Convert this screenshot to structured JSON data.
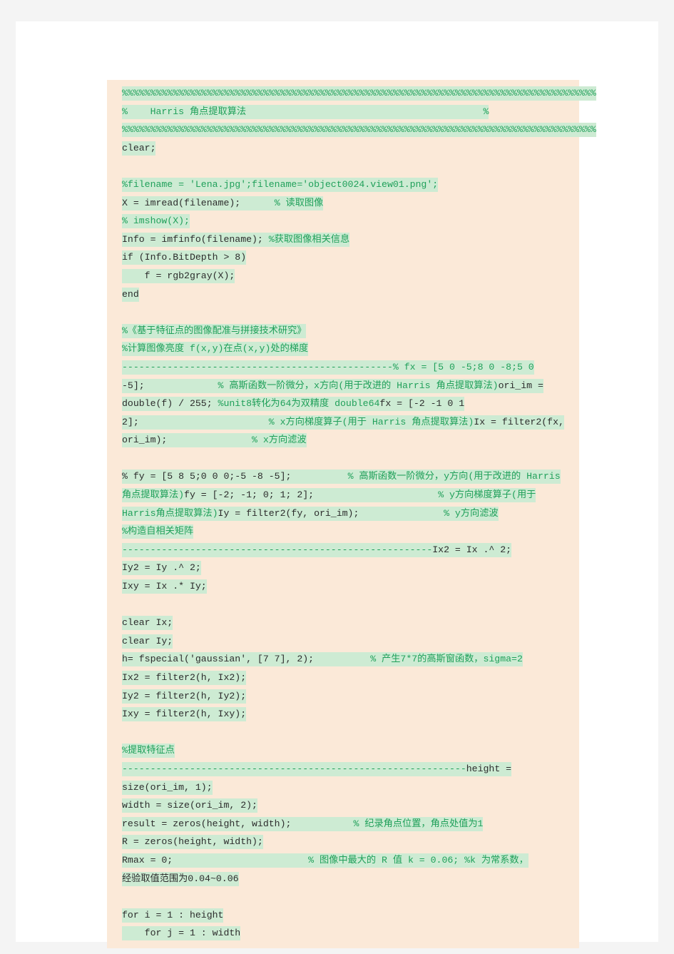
{
  "document": {
    "kind": "code-listing",
    "language": "MATLAB",
    "page_background": "#ffffff",
    "canvas_background": "#f4f4f4",
    "code_block_background": "#fbe9d8",
    "highlight_background": "#cdebd3",
    "code_text_color": "#2c2c2c",
    "comment_text_color": "#20a05a"
  },
  "code_lines": [
    {
      "id": "l01",
      "kind": "comment-banner",
      "text": "%%%%%%%%%%%%%%%%%%%%%%%%%%%%%%%%%%%%%%%%%%%%%%%%%%%%%%%%%%%%%%%%%%%%%%%%%%%%%%%%%%%%%"
    },
    {
      "id": "l02",
      "kind": "comment-title",
      "text": "%    Harris 角点提取算法                                          %"
    },
    {
      "id": "l03",
      "kind": "comment-banner",
      "text": "%%%%%%%%%%%%%%%%%%%%%%%%%%%%%%%%%%%%%%%%%%%%%%%%%%%%%%%%%%%%%%%%%%%%%%%%%%%%%%%%%%%%%"
    },
    {
      "id": "l04",
      "kind": "code",
      "text": "clear;"
    },
    {
      "id": "l05",
      "kind": "spacer",
      "text": ""
    },
    {
      "id": "l06",
      "kind": "comment",
      "text": "%filename = 'Lena.jpg';filename='object0024.view01.png';"
    },
    {
      "id": "l07",
      "kind": "code",
      "text": "X = imread(filename);      % 读取图像"
    },
    {
      "id": "l08",
      "kind": "comment",
      "text": "% imshow(X);"
    },
    {
      "id": "l09",
      "kind": "code",
      "text": "Info = imfinfo(filename); %获取图像相关信息"
    },
    {
      "id": "l10",
      "kind": "code",
      "text": "if (Info.BitDepth > 8)"
    },
    {
      "id": "l11",
      "kind": "code",
      "text": "    f = rgb2gray(X);"
    },
    {
      "id": "l12",
      "kind": "code",
      "text": "end"
    },
    {
      "id": "l13",
      "kind": "spacer",
      "text": ""
    },
    {
      "id": "l14",
      "kind": "comment",
      "text": "%《基于特征点的图像配准与拼接技术研究》"
    },
    {
      "id": "l15",
      "kind": "comment",
      "text": "%计算图像亮度 f(x,y)在点(x,y)处的梯度"
    },
    {
      "id": "l16",
      "kind": "comment",
      "text": "------------------------------------------------% fx = [5 0 -5;8 0 -8;5 0"
    },
    {
      "id": "l17",
      "kind": "mixed",
      "text": "-5];             % 高斯函数一阶微分，x方向(用于改进的 Harris 角点提取算法)ori_im ="
    },
    {
      "id": "l18",
      "kind": "mixed",
      "text": "double(f) / 255; %unit8转化为64为双精度 double64fx = [-2 -1 0 1"
    },
    {
      "id": "l19",
      "kind": "mixed",
      "text": "2];                       % x方向梯度算子(用于 Harris 角点提取算法)Ix = filter2(fx,"
    },
    {
      "id": "l20",
      "kind": "mixed",
      "text": "ori_im);               % x方向滤波"
    },
    {
      "id": "l21",
      "kind": "spacer",
      "text": ""
    },
    {
      "id": "l22",
      "kind": "mixed",
      "text": "% fy = [5 8 5;0 0 0;-5 -8 -5];          % 高斯函数一阶微分，y方向(用于改进的 Harris"
    },
    {
      "id": "l23",
      "kind": "mixed",
      "text": "角点提取算法)fy = [-2; -1; 0; 1; 2];                      % y方向梯度算子(用于"
    },
    {
      "id": "l24",
      "kind": "mixed",
      "text": "Harris角点提取算法)Iy = filter2(fy, ori_im);               % y方向滤波"
    },
    {
      "id": "l25",
      "kind": "comment",
      "text": "%构造自相关矩阵"
    },
    {
      "id": "l26",
      "kind": "mixed",
      "text": "-------------------------------------------------------Ix2 = Ix .^ 2;"
    },
    {
      "id": "l27",
      "kind": "code",
      "text": "Iy2 = Iy .^ 2;"
    },
    {
      "id": "l28",
      "kind": "code",
      "text": "Ixy = Ix .* Iy;"
    },
    {
      "id": "l29",
      "kind": "spacer",
      "text": ""
    },
    {
      "id": "l30",
      "kind": "code",
      "text": "clear Ix;"
    },
    {
      "id": "l31",
      "kind": "code",
      "text": "clear Iy;"
    },
    {
      "id": "l32",
      "kind": "code",
      "text": "h= fspecial('gaussian', [7 7], 2);          % 产生7*7的高斯窗函数，sigma=2"
    },
    {
      "id": "l33",
      "kind": "code",
      "text": "Ix2 = filter2(h, Ix2);"
    },
    {
      "id": "l34",
      "kind": "code",
      "text": "Iy2 = filter2(h, Iy2);"
    },
    {
      "id": "l35",
      "kind": "code",
      "text": "Ixy = filter2(h, Ixy);"
    },
    {
      "id": "l36",
      "kind": "spacer",
      "text": ""
    },
    {
      "id": "l37",
      "kind": "comment",
      "text": "%提取特征点"
    },
    {
      "id": "l38",
      "kind": "mixed",
      "text": "-------------------------------------------------------------height ="
    },
    {
      "id": "l39",
      "kind": "code",
      "text": "size(ori_im, 1);"
    },
    {
      "id": "l40",
      "kind": "code",
      "text": "width = size(ori_im, 2);"
    },
    {
      "id": "l41",
      "kind": "code",
      "text": "result = zeros(height, width);           % 纪录角点位置，角点处值为1"
    },
    {
      "id": "l42",
      "kind": "code",
      "text": "R = zeros(height, width);"
    },
    {
      "id": "l43",
      "kind": "code",
      "text": "Rmax = 0;                        % 图像中最大的 R 值 k = 0.06; %k 为常系数，"
    },
    {
      "id": "l44",
      "kind": "code",
      "text": "经验取值范围为0.04~0.06"
    },
    {
      "id": "l45",
      "kind": "spacer",
      "text": ""
    },
    {
      "id": "l46",
      "kind": "code",
      "text": "for i = 1 : height"
    },
    {
      "id": "l47",
      "kind": "code",
      "text": "    for j = 1 : width"
    }
  ],
  "segments": {
    "l01": [
      {
        "t": "%%%%%%%%%%%%%%%%%%%%%%%%%%%%%%%%%%%%%%%%%%%%%%%%%%%%%%%%%%%%%%%%%%%%%%%%%%%%%%%%%%%%",
        "c": "cmt"
      }
    ],
    "l02": [
      {
        "t": "%    Harris 角点提取算法                                          %",
        "c": "cmt"
      }
    ],
    "l03": [
      {
        "t": "%%%%%%%%%%%%%%%%%%%%%%%%%%%%%%%%%%%%%%%%%%%%%%%%%%%%%%%%%%%%%%%%%%%%%%%%%%%%%%%%%%%%",
        "c": "cmt"
      }
    ],
    "l04": [
      {
        "t": "clear;",
        "c": "code"
      }
    ],
    "l06": [
      {
        "t": "%filename = 'Lena.jpg';filename='object0024.view01.png';",
        "c": "cmt"
      }
    ],
    "l07": [
      {
        "t": "X = imread(filename);",
        "c": "code"
      },
      {
        "t": "      ",
        "c": "code"
      },
      {
        "t": "% 读取图像",
        "c": "cmt"
      }
    ],
    "l08": [
      {
        "t": "% imshow(X);",
        "c": "cmt"
      }
    ],
    "l09": [
      {
        "t": "Info = imfinfo(filename); ",
        "c": "code"
      },
      {
        "t": "%获取图像相关信息",
        "c": "cmt"
      }
    ],
    "l10": [
      {
        "t": "if (Info.BitDepth > 8)",
        "c": "code"
      }
    ],
    "l11": [
      {
        "t": "    f = rgb2gray(X);",
        "c": "code"
      }
    ],
    "l12": [
      {
        "t": "end",
        "c": "code"
      }
    ],
    "l14": [
      {
        "t": "%《基于特征点的图像配准与拼接技术研究》",
        "c": "cmt"
      }
    ],
    "l15": [
      {
        "t": "%计算图像亮度 f(x,y)在点(x,y)处的梯度",
        "c": "cmt"
      }
    ],
    "l16": [
      {
        "t": "------------------------------------------------",
        "c": "cmt"
      },
      {
        "t": "% fx = [5 0 -5;8 0 -8;5 0",
        "c": "cmt"
      }
    ],
    "l17": [
      {
        "t": "-5];",
        "c": "code"
      },
      {
        "t": "             ",
        "c": "code"
      },
      {
        "t": "% 高斯函数一阶微分，x方向(用于改进的 Harris 角点提取算法)",
        "c": "cmt"
      },
      {
        "t": "ori_im =",
        "c": "code"
      }
    ],
    "l18": [
      {
        "t": "double(f) / 255; ",
        "c": "code"
      },
      {
        "t": "%unit8转化为64为双精度 double64",
        "c": "cmt"
      },
      {
        "t": "fx = [-2 -1 0 1",
        "c": "code"
      }
    ],
    "l19": [
      {
        "t": "2];                       ",
        "c": "code"
      },
      {
        "t": "% x方向梯度算子(用于 Harris 角点提取算法)",
        "c": "cmt"
      },
      {
        "t": "Ix = filter2(fx,",
        "c": "code"
      }
    ],
    "l20": [
      {
        "t": "ori_im);               ",
        "c": "code"
      },
      {
        "t": "% x方向滤波",
        "c": "cmt"
      }
    ],
    "l22": [
      {
        "t": "% fy = [5 8 5;0 0 0;-5 -8 -5];",
        "c": "code"
      },
      {
        "t": "          ",
        "c": "code"
      },
      {
        "t": "% 高斯函数一阶微分，y方向(用于改进的 Harris",
        "c": "cmt"
      }
    ],
    "l23": [
      {
        "t": "角点提取算法)",
        "c": "cmt"
      },
      {
        "t": "fy = [-2; -1; 0; 1; 2];",
        "c": "code"
      },
      {
        "t": "                      ",
        "c": "code"
      },
      {
        "t": "% y方向梯度算子(用于",
        "c": "cmt"
      }
    ],
    "l24": [
      {
        "t": "Harris角点提取算法)",
        "c": "cmt"
      },
      {
        "t": "Iy = filter2(fy, ori_im);",
        "c": "code"
      },
      {
        "t": "               ",
        "c": "code"
      },
      {
        "t": "% y方向滤波",
        "c": "cmt"
      }
    ],
    "l25": [
      {
        "t": "%构造自相关矩阵",
        "c": "cmt"
      }
    ],
    "l26": [
      {
        "t": "-------------------------------------------------------",
        "c": "cmt"
      },
      {
        "t": "Ix2 = Ix .^ 2;",
        "c": "code"
      }
    ],
    "l27": [
      {
        "t": "Iy2 = Iy .^ 2;",
        "c": "code"
      }
    ],
    "l28": [
      {
        "t": "Ixy = Ix .* Iy;",
        "c": "code"
      }
    ],
    "l30": [
      {
        "t": "clear Ix;",
        "c": "code"
      }
    ],
    "l31": [
      {
        "t": "clear Iy;",
        "c": "code"
      }
    ],
    "l32": [
      {
        "t": "h= fspecial('gaussian', [7 7], 2);",
        "c": "code"
      },
      {
        "t": "          ",
        "c": "code"
      },
      {
        "t": "% 产生7*7的高斯窗函数，sigma=2",
        "c": "cmt"
      }
    ],
    "l33": [
      {
        "t": "Ix2 = filter2(h, Ix2);",
        "c": "code"
      }
    ],
    "l34": [
      {
        "t": "Iy2 = filter2(h, Iy2);",
        "c": "code"
      }
    ],
    "l35": [
      {
        "t": "Ixy = filter2(h, Ixy);",
        "c": "code"
      }
    ],
    "l37": [
      {
        "t": "%提取特征点",
        "c": "cmt"
      }
    ],
    "l38": [
      {
        "t": "-------------------------------------------------------------",
        "c": "cmt"
      },
      {
        "t": "height =",
        "c": "code"
      }
    ],
    "l39": [
      {
        "t": "size(ori_im, 1);",
        "c": "code"
      }
    ],
    "l40": [
      {
        "t": "width = size(ori_im, 2);",
        "c": "code"
      }
    ],
    "l41": [
      {
        "t": "result = zeros(height, width);",
        "c": "code"
      },
      {
        "t": "           ",
        "c": "code"
      },
      {
        "t": "% 纪录角点位置，角点处值为1",
        "c": "cmt"
      }
    ],
    "l42": [
      {
        "t": "R = zeros(height, width);",
        "c": "code"
      }
    ],
    "l43": [
      {
        "t": "Rmax = 0;",
        "c": "code"
      },
      {
        "t": "                        ",
        "c": "code"
      },
      {
        "t": "% 图像中最大的 R 值 k = 0.06; %k 为常系数，",
        "c": "cmt"
      }
    ],
    "l44": [
      {
        "t": "经验取值范围为0.04~0.06",
        "c": "code"
      }
    ],
    "l46": [
      {
        "t": "for i = 1 : height",
        "c": "code"
      }
    ],
    "l47": [
      {
        "t": "    for j = 1 : width",
        "c": "code"
      }
    ]
  }
}
